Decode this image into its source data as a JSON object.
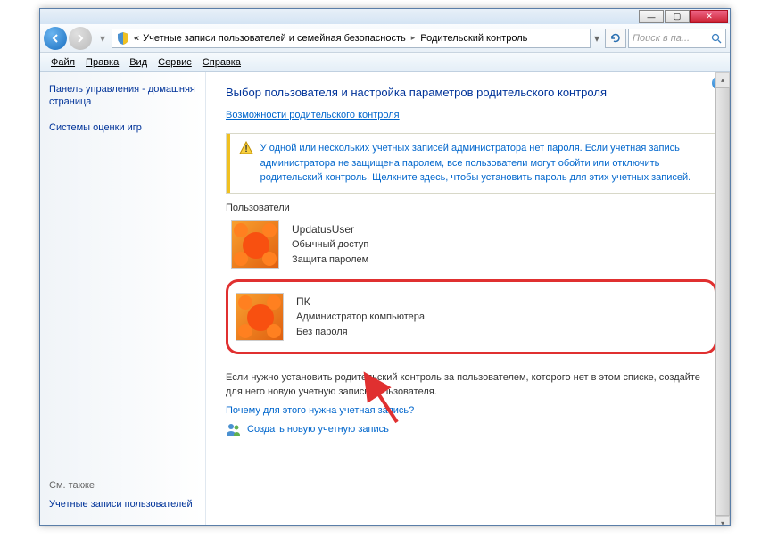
{
  "window": {
    "min": "—",
    "max": "▢",
    "close": "✕"
  },
  "address": {
    "prefix": "«",
    "path1": "Учетные записи пользователей и семейная безопасность",
    "path2": "Родительский контроль"
  },
  "search": {
    "placeholder": "Поиск в па..."
  },
  "menu": {
    "file": "Файл",
    "edit": "Правка",
    "view": "Вид",
    "tools": "Сервис",
    "help": "Справка"
  },
  "sidebar": {
    "home": "Панель управления - домашняя страница",
    "ratings": "Системы оценки игр",
    "seealso": "См. также",
    "accounts": "Учетные записи пользователей"
  },
  "content": {
    "heading": "Выбор пользователя и настройка параметров родительского контроля",
    "sublink": "Возможности родительского контроля",
    "warning": "У одной или нескольких учетных записей администратора нет пароля. Если учетная запись администратора не защищена паролем, все пользователи могут обойти или отключить родительский контроль. Щелкните здесь, чтобы установить пароль для этих учетных записей.",
    "users_label": "Пользователи",
    "users": [
      {
        "name": "UpdatusUser",
        "role": "Обычный доступ",
        "pass": "Защита паролем"
      },
      {
        "name": "ПК",
        "role": "Администратор компьютера",
        "pass": "Без пароля"
      }
    ],
    "note": "Если нужно установить родительский контроль за пользователем, которого нет в этом списке, создайте для него новую учетную запись пользователя.",
    "whylink": "Почему для этого нужна учетная запись?",
    "createlink": "Создать новую учетную запись"
  }
}
